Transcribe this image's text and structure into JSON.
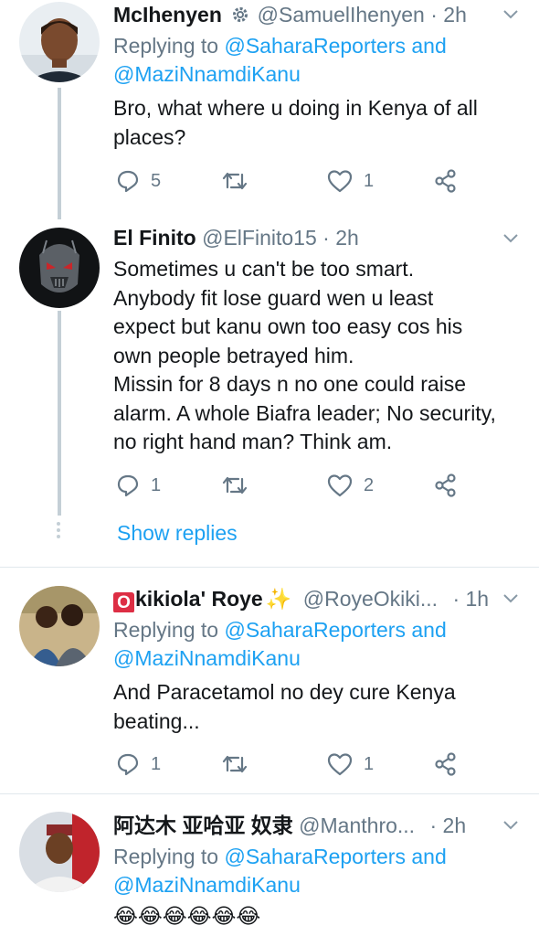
{
  "tweets": [
    {
      "name": "McIhenyen",
      "handle": "@SamuelIhenyen",
      "time": "2h",
      "reply_prefix": "Replying to",
      "reply_to_line1": "@SaharaReporters and",
      "reply_to_line2": "@MaziNnamdiKanu",
      "text_lines": [
        "Bro, what where u doing in Kenya of all",
        "places?"
      ],
      "replies": "5",
      "retweets": "",
      "likes": "1"
    },
    {
      "name": "El Finito",
      "handle": "@ElFinito15",
      "time": "2h",
      "text_lines": [
        "Sometimes u can't be too smart.",
        "Anybody fit lose guard wen u least",
        "expect but kanu own too easy cos his",
        "own people betrayed him.",
        "Missin for 8 days n no one could raise",
        "alarm. A whole Biafra leader; No security,",
        "no right hand man? Think am."
      ],
      "replies": "1",
      "retweets": "",
      "likes": "2",
      "show_replies": "Show replies"
    },
    {
      "name_badge": "O",
      "name": "kikiola' Roye",
      "name_emoji": "✨",
      "handle": "@RoyeOkiki...",
      "time": "1h",
      "reply_prefix": "Replying to",
      "reply_to_line1": "@SaharaReporters and",
      "reply_to_line2": "@MaziNnamdiKanu",
      "text_lines": [
        "And Paracetamol no dey cure Kenya",
        "beating..."
      ],
      "replies": "1",
      "retweets": "",
      "likes": "1"
    },
    {
      "name": "阿达木 亚哈亚 奴隶",
      "handle": "@Manthro...",
      "time": "2h",
      "reply_prefix": "Replying to",
      "reply_to_line1": "@SaharaReporters and",
      "reply_to_line2": "@MaziNnamdiKanu",
      "text_lines": [
        "😂😂😂😂😂😂"
      ]
    }
  ],
  "separator_dot": "·",
  "colors": {
    "link": "#1da1f2",
    "muted": "#657786",
    "thread_line": "#c4cfd6"
  }
}
